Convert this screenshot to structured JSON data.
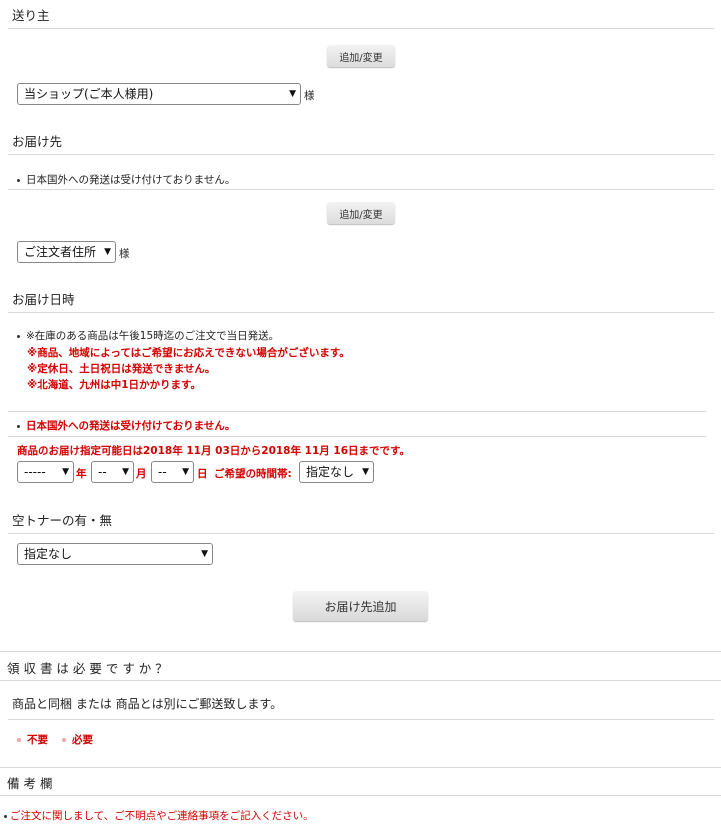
{
  "sender": {
    "title": "送り主",
    "add_change_label": "追加/変更",
    "select_value": "当ショップ(ご本人様用)",
    "suffix": "様"
  },
  "delivery_dest": {
    "title": "お届け先",
    "notice": "日本国外への発送は受け付けておりません。",
    "add_change_label": "追加/変更",
    "select_value": "ご注文者住所",
    "suffix": "様"
  },
  "delivery_date": {
    "title": "お届け日時",
    "note_main": "※在庫のある商品は午後15時迄のご注文で当日発送。",
    "note_red1": "※商品、地域によってはご希望にお応えできない場合がございます。",
    "note_red2": "※定休日、土日祝日は発送できません。",
    "note_red3": "※北海道、九州は中1日かかります。",
    "notice_red": "日本国外への発送は受け付けておりません。",
    "range_text": "商品のお届け指定可能日は2018年 11月 03日から2018年 11月 16日までです。",
    "year_value": "-----",
    "year_label": "年",
    "month_value": "--",
    "month_label": "月",
    "day_value": "--",
    "day_label": "日",
    "time_label": "ご希望の時間帯:",
    "time_value": "指定なし"
  },
  "toner": {
    "title": "空トナーの有・無",
    "select_value": "指定なし"
  },
  "add_destination_label": "お届け先追加",
  "receipt": {
    "title": "領 収 書 は 必 要 で す か ？",
    "description": "商品と同梱 または 商品とは別にご郵送致します。",
    "option_no": "不要",
    "option_yes": "必要"
  },
  "remarks": {
    "title": "備 考 欄",
    "notice": "ご注文に関しまして、ご不明点やご連絡事項をご記入ください。"
  }
}
